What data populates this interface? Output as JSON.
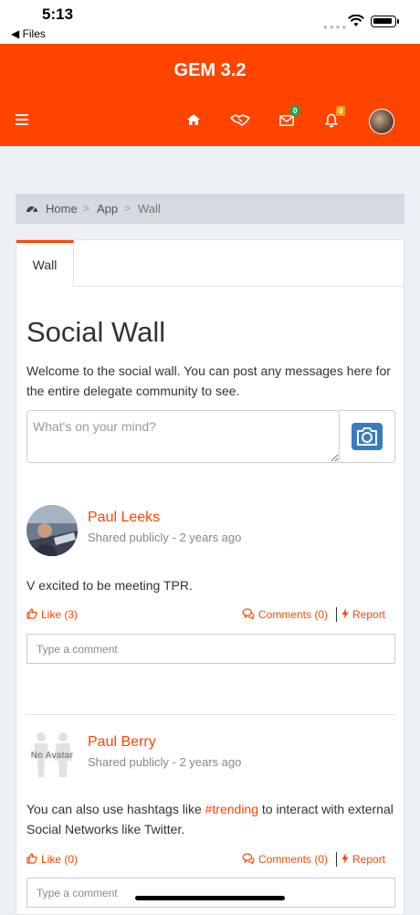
{
  "status": {
    "time": "5:13",
    "back_label": "◀ Files"
  },
  "header": {
    "title": "GEM 3.2",
    "mail_count": "0",
    "notification_count": "0",
    "accent": "#ff4400"
  },
  "breadcrumb": {
    "home": "Home",
    "app": "App",
    "current": "Wall",
    "separator": ">"
  },
  "tabs": [
    {
      "label": "Wall"
    }
  ],
  "page": {
    "title": "Social Wall",
    "intro": "Welcome to the social wall. You can post any messages here for the entire delegate community to see.",
    "post_placeholder": "What's on your mind?"
  },
  "posts": [
    {
      "author": "Paul Leeks",
      "meta": "Shared publicly - 2 years ago",
      "body": "V excited to be meeting TPR.",
      "like_label": "Like (3)",
      "comments_label": "Comments (0)",
      "report_label": "Report",
      "comment_placeholder": "Type a comment"
    },
    {
      "author": "Paul Berry",
      "meta": "Shared publicly - 2 years ago",
      "body_before": "You can also use hashtags like ",
      "hashtag": "#trending",
      "body_after": " to interact with external Social Networks like Twitter.",
      "avatar_label": "No Avatar",
      "like_label": "Like (0)",
      "comments_label": "Comments (0)",
      "report_label": "Report",
      "comment_placeholder": "Type a comment"
    }
  ]
}
